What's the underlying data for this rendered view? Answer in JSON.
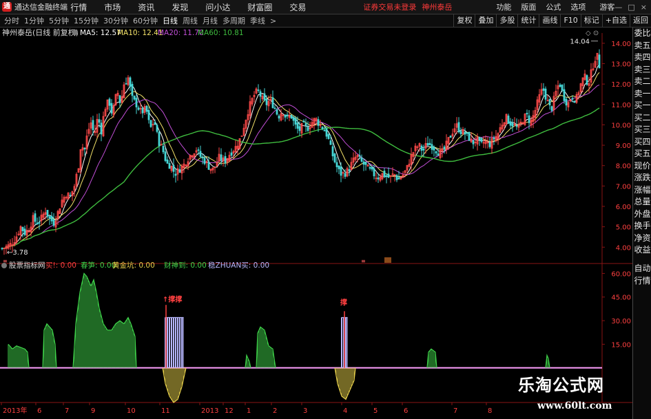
{
  "app": {
    "logo_text": "通",
    "title": "通达信金融终端"
  },
  "menu": [
    "行情",
    "市场",
    "资讯",
    "发现",
    "问小达",
    "财富圈",
    "交易"
  ],
  "status": {
    "login": "证券交易未登录",
    "stock_name": "神州泰岳"
  },
  "right_menu": [
    "功能",
    "版面",
    "公式",
    "选项"
  ],
  "guest": "游客",
  "window_controls": [
    "—",
    "□",
    "×"
  ],
  "periods": [
    "分时",
    "1分钟",
    "5分钟",
    "15分钟",
    "30分钟",
    "60分钟",
    "日线",
    "周线",
    "月线",
    "多周期",
    "季线",
    ">"
  ],
  "active_period": "日线",
  "toolbar_buttons": [
    "复权",
    "叠加",
    "多股",
    "统计",
    "画线",
    "F10",
    "标记",
    "+自选",
    "返回"
  ],
  "sidebar_top": [
    "委比",
    "卖五",
    "卖四",
    "卖三",
    "卖二",
    "卖一",
    "买一",
    "买二",
    "买三",
    "买四",
    "买五",
    "现价",
    "涨跌",
    "涨幅",
    "总量",
    "外盘",
    "换手",
    "净资",
    "收益"
  ],
  "sidebar_bottom": [
    "自动",
    "行情"
  ],
  "colors": {
    "up": "#ff4a4a",
    "down": "#46d6d6",
    "ma5": "#ffffff",
    "ma10": "#f4e36a",
    "ma20": "#c24fd8",
    "ma60": "#3fbd3f",
    "ind_green": "#3fd44a",
    "ind_yellow": "#e6cf4a",
    "ind_blue": "#b7b7ff",
    "ind_magenta": "#ff4fff",
    "ind_red": "#ff4040"
  },
  "chart_data": {
    "type": "candlestick",
    "title": "神州泰岳(日线 前复权)",
    "ma_labels": [
      {
        "name": "MA5",
        "value": "12.57"
      },
      {
        "name": "MA10",
        "value": "12.41"
      },
      {
        "name": "MA20",
        "value": "11.70"
      },
      {
        "name": "MA60",
        "value": "10.81"
      }
    ],
    "y_ticks": [
      "14.00",
      "13.00",
      "12.00",
      "11.00",
      "10.00",
      "9.00",
      "8.00",
      "7.00",
      "6.00",
      "5.00",
      "4.00"
    ],
    "ylim": [
      3.3,
      14.3
    ],
    "high_label": "14.04",
    "low_label": "3.78",
    "close_path": [
      [
        0,
        3.9
      ],
      [
        8,
        4.0
      ],
      [
        14,
        4.1
      ],
      [
        20,
        4.3
      ],
      [
        25,
        4.6
      ],
      [
        30,
        5.0
      ],
      [
        36,
        4.7
      ],
      [
        42,
        4.9
      ],
      [
        48,
        5.4
      ],
      [
        53,
        5.2
      ],
      [
        58,
        5.3
      ],
      [
        66,
        5.8
      ],
      [
        72,
        5.4
      ],
      [
        78,
        5.2
      ],
      [
        84,
        5.7
      ],
      [
        90,
        6.3
      ],
      [
        96,
        6.6
      ],
      [
        102,
        6.5
      ],
      [
        108,
        7.0
      ],
      [
        114,
        8.0
      ],
      [
        118,
        9.2
      ],
      [
        122,
        8.6
      ],
      [
        127,
        9.6
      ],
      [
        132,
        10.1
      ],
      [
        137,
        9.5
      ],
      [
        142,
        10.4
      ],
      [
        147,
        9.7
      ],
      [
        152,
        10.8
      ],
      [
        158,
        11.2
      ],
      [
        163,
        10.5
      ],
      [
        170,
        11.7
      ],
      [
        175,
        11.0
      ],
      [
        180,
        12.0
      ],
      [
        186,
        12.3
      ],
      [
        192,
        11.3
      ],
      [
        198,
        11.0
      ],
      [
        205,
        10.6
      ],
      [
        212,
        10.8
      ],
      [
        218,
        9.8
      ],
      [
        224,
        10.2
      ],
      [
        230,
        9.2
      ],
      [
        236,
        8.8
      ],
      [
        242,
        8.1
      ],
      [
        248,
        8.0
      ],
      [
        254,
        7.6
      ],
      [
        260,
        7.8
      ],
      [
        266,
        8.0
      ],
      [
        272,
        8.3
      ],
      [
        278,
        8.6
      ],
      [
        285,
        8.8
      ],
      [
        292,
        8.4
      ],
      [
        298,
        8.2
      ],
      [
        304,
        7.9
      ],
      [
        310,
        7.8
      ],
      [
        318,
        8.4
      ],
      [
        326,
        8.2
      ],
      [
        334,
        8.6
      ],
      [
        342,
        8.9
      ],
      [
        350,
        9.4
      ],
      [
        356,
        10.2
      ],
      [
        362,
        10.9
      ],
      [
        368,
        11.4
      ],
      [
        374,
        11.7
      ],
      [
        380,
        11.3
      ],
      [
        386,
        11.0
      ],
      [
        392,
        11.2
      ],
      [
        398,
        10.9
      ],
      [
        404,
        10.4
      ],
      [
        410,
        10.7
      ],
      [
        416,
        10.3
      ],
      [
        422,
        10.5
      ],
      [
        428,
        10.0
      ],
      [
        434,
        9.7
      ],
      [
        440,
        10.0
      ],
      [
        446,
        9.8
      ],
      [
        452,
        10.1
      ],
      [
        458,
        10.3
      ],
      [
        464,
        10.0
      ],
      [
        470,
        9.8
      ],
      [
        476,
        9.4
      ],
      [
        482,
        8.6
      ],
      [
        488,
        8.0
      ],
      [
        494,
        7.6
      ],
      [
        500,
        7.6
      ],
      [
        506,
        7.8
      ],
      [
        512,
        8.2
      ],
      [
        518,
        8.5
      ],
      [
        524,
        8.2
      ],
      [
        530,
        8.0
      ],
      [
        536,
        7.8
      ],
      [
        542,
        7.6
      ],
      [
        548,
        7.4
      ],
      [
        554,
        7.6
      ],
      [
        560,
        7.5
      ],
      [
        566,
        7.4
      ],
      [
        572,
        7.6
      ],
      [
        578,
        7.3
      ],
      [
        584,
        7.5
      ],
      [
        590,
        7.8
      ],
      [
        596,
        8.4
      ],
      [
        602,
        8.8
      ],
      [
        608,
        9.0
      ],
      [
        614,
        8.7
      ],
      [
        620,
        9.1
      ],
      [
        626,
        9.0
      ],
      [
        632,
        8.8
      ],
      [
        638,
        8.6
      ],
      [
        644,
        8.7
      ],
      [
        650,
        9.2
      ],
      [
        656,
        9.6
      ],
      [
        662,
        10.0
      ],
      [
        668,
        9.7
      ],
      [
        674,
        9.6
      ],
      [
        680,
        9.4
      ],
      [
        686,
        9.1
      ],
      [
        692,
        9.3
      ],
      [
        698,
        9.0
      ],
      [
        704,
        9.2
      ],
      [
        710,
        9.0
      ],
      [
        716,
        9.3
      ],
      [
        722,
        9.5
      ],
      [
        728,
        10.0
      ],
      [
        734,
        10.4
      ],
      [
        740,
        10.1
      ],
      [
        746,
        10.0
      ],
      [
        752,
        9.8
      ],
      [
        758,
        10.2
      ],
      [
        764,
        10.5
      ],
      [
        770,
        10.1
      ],
      [
        776,
        10.6
      ],
      [
        782,
        11.3
      ],
      [
        788,
        11.8
      ],
      [
        794,
        11.2
      ],
      [
        800,
        10.7
      ],
      [
        806,
        11.5
      ],
      [
        812,
        12.1
      ],
      [
        818,
        11.4
      ],
      [
        824,
        11.0
      ],
      [
        830,
        11.4
      ],
      [
        836,
        11.2
      ],
      [
        842,
        11.9
      ],
      [
        848,
        12.4
      ],
      [
        854,
        12.0
      ],
      [
        860,
        12.8
      ],
      [
        866,
        13.5
      ],
      [
        872,
        12.6
      ],
      [
        874,
        12.7
      ]
    ],
    "indicator": {
      "name": "股票指标网",
      "labels": [
        {
          "name": "买!",
          "value": "0.00"
        },
        {
          "name": "春笋",
          "value": "0.00"
        },
        {
          "name": "黄金坑",
          "value": "0.00"
        },
        {
          "name": "财神到",
          "value": "0.00"
        },
        {
          "name": "稳ZHUAN买",
          "value": "0.00"
        }
      ],
      "y_ticks": [
        "60.00",
        "45.00",
        "30.00",
        "15.00"
      ],
      "ylim": [
        -22,
        65
      ],
      "markers": [
        "↑撑撑",
        "撑"
      ],
      "green_segments": [
        [
          [
            12,
            15
          ],
          [
            18,
            12
          ],
          [
            24,
            14
          ],
          [
            30,
            13
          ],
          [
            36,
            12
          ],
          [
            40,
            10
          ],
          [
            42,
            0
          ]
        ],
        [
          [
            62,
            0
          ],
          [
            64,
            24
          ],
          [
            68,
            28
          ],
          [
            72,
            26
          ],
          [
            76,
            24
          ],
          [
            80,
            15
          ],
          [
            82,
            0
          ]
        ],
        [
          [
            106,
            0
          ],
          [
            110,
            28
          ],
          [
            116,
            48
          ],
          [
            122,
            60
          ],
          [
            126,
            58
          ],
          [
            132,
            52
          ],
          [
            136,
            56
          ],
          [
            140,
            48
          ],
          [
            144,
            38
          ],
          [
            150,
            28
          ],
          [
            156,
            24
          ],
          [
            162,
            24
          ],
          [
            168,
            28
          ],
          [
            174,
            30
          ],
          [
            180,
            28
          ],
          [
            186,
            32
          ],
          [
            190,
            28
          ],
          [
            196,
            20
          ],
          [
            198,
            0
          ]
        ],
        [
          [
            356,
            0
          ],
          [
            358,
            8
          ],
          [
            362,
            4
          ],
          [
            364,
            0
          ]
        ],
        [
          [
            372,
            0
          ],
          [
            374,
            22
          ],
          [
            378,
            26
          ],
          [
            384,
            24
          ],
          [
            390,
            14
          ],
          [
            396,
            12
          ],
          [
            400,
            0
          ]
        ],
        [
          [
            620,
            0
          ],
          [
            622,
            10
          ],
          [
            626,
            12
          ],
          [
            632,
            10
          ],
          [
            634,
            0
          ]
        ],
        [
          [
            792,
            0
          ],
          [
            794,
            8
          ],
          [
            796,
            6
          ],
          [
            798,
            0
          ]
        ]
      ],
      "yellow_segments": [
        [
          [
            236,
            0
          ],
          [
            240,
            -10
          ],
          [
            246,
            -18
          ],
          [
            252,
            -22
          ],
          [
            258,
            -20
          ],
          [
            264,
            -12
          ],
          [
            268,
            -4
          ],
          [
            270,
            0
          ]
        ],
        [
          [
            486,
            0
          ],
          [
            490,
            -10
          ],
          [
            496,
            -18
          ],
          [
            502,
            -20
          ],
          [
            508,
            -14
          ],
          [
            514,
            -8
          ],
          [
            516,
            0
          ]
        ]
      ],
      "blue_bars": [
        {
          "from": 240,
          "to": 266,
          "value": 32
        },
        {
          "from": 496,
          "to": 504,
          "value": 32
        }
      ],
      "red_bars": [
        {
          "x": 241,
          "value": 40
        },
        {
          "x": 500,
          "value": 36
        }
      ]
    },
    "x_ticks": [
      "2013年",
      "6",
      "7",
      "9",
      "10",
      "11",
      "2013",
      "12",
      "1",
      "2",
      "3",
      "4",
      "5",
      "6",
      "7",
      "8"
    ]
  },
  "watermark": {
    "cn": "乐淘公式网",
    "url": "www.60lt.com"
  }
}
